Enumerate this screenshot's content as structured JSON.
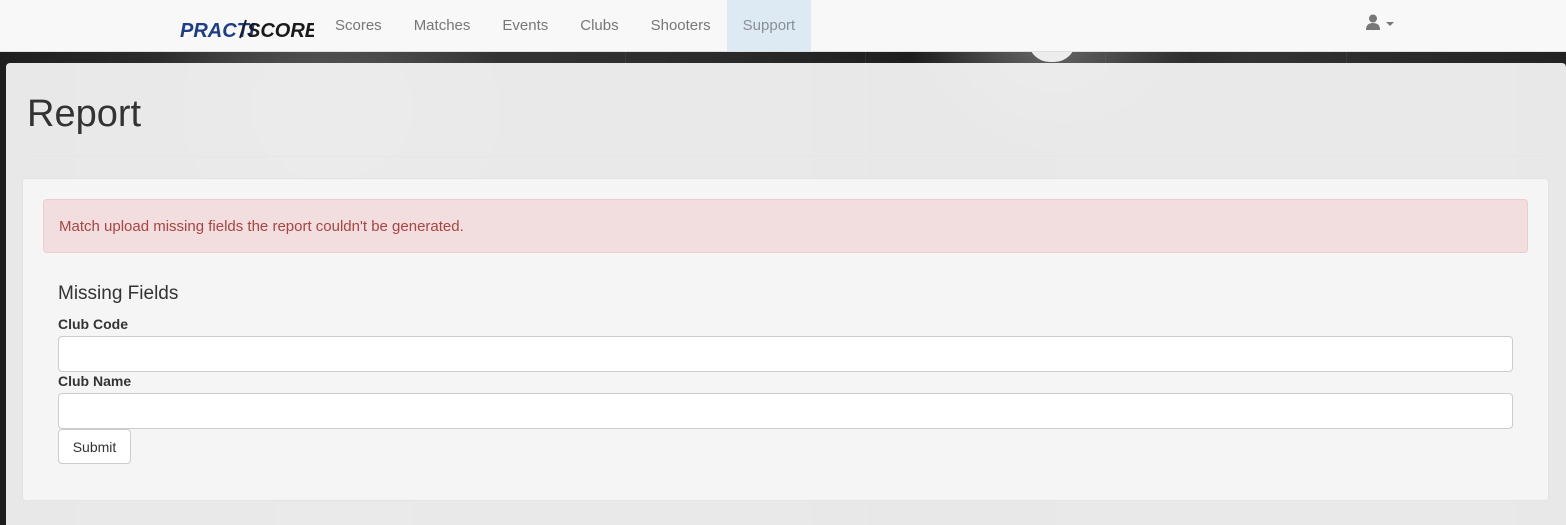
{
  "navbar": {
    "brand": "PRACTISCORE",
    "items": [
      {
        "label": "Scores",
        "active": false
      },
      {
        "label": "Matches",
        "active": false
      },
      {
        "label": "Events",
        "active": false
      },
      {
        "label": "Clubs",
        "active": false
      },
      {
        "label": "Shooters",
        "active": false
      },
      {
        "label": "Support",
        "active": true
      }
    ],
    "user_icon": "user-icon"
  },
  "page": {
    "title": "Report"
  },
  "alert": {
    "message": "Match upload missing fields the report couldn't be generated."
  },
  "form": {
    "section_title": "Missing Fields",
    "fields": [
      {
        "label": "Club Code",
        "value": "",
        "placeholder": ""
      },
      {
        "label": "Club Name",
        "value": "",
        "placeholder": ""
      }
    ],
    "submit_label": "Submit"
  },
  "colors": {
    "brand_blue": "#1f3c88",
    "brand_dark": "#1a1a1a",
    "alert_bg": "#f2dede",
    "alert_text": "#a94442",
    "active_nav_bg": "#ddeaf3"
  }
}
